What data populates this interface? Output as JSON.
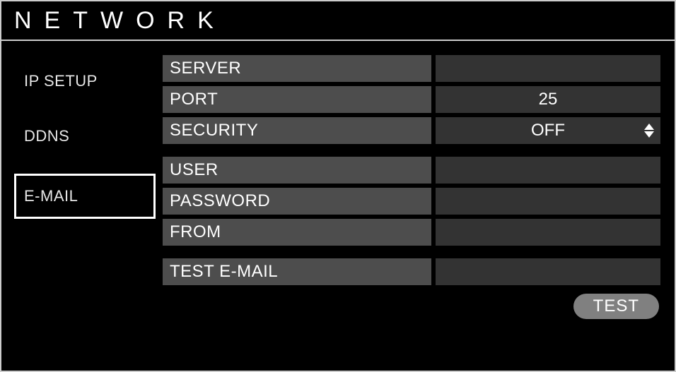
{
  "title": "NETWORK",
  "sidebar": {
    "items": [
      {
        "label": "IP SETUP",
        "selected": false
      },
      {
        "label": "DDNS",
        "selected": false
      },
      {
        "label": "E-MAIL",
        "selected": true
      }
    ]
  },
  "fields": {
    "group1": [
      {
        "label": "SERVER",
        "value": "",
        "type": "text"
      },
      {
        "label": "PORT",
        "value": "25",
        "type": "text"
      },
      {
        "label": "SECURITY",
        "value": "OFF",
        "type": "spinner"
      }
    ],
    "group2": [
      {
        "label": "USER",
        "value": "",
        "type": "text"
      },
      {
        "label": "PASSWORD",
        "value": "",
        "type": "text"
      },
      {
        "label": "FROM",
        "value": "",
        "type": "text"
      }
    ],
    "group3": [
      {
        "label": "TEST E-MAIL",
        "value": "",
        "type": "text"
      }
    ]
  },
  "buttons": {
    "test": "TEST"
  }
}
